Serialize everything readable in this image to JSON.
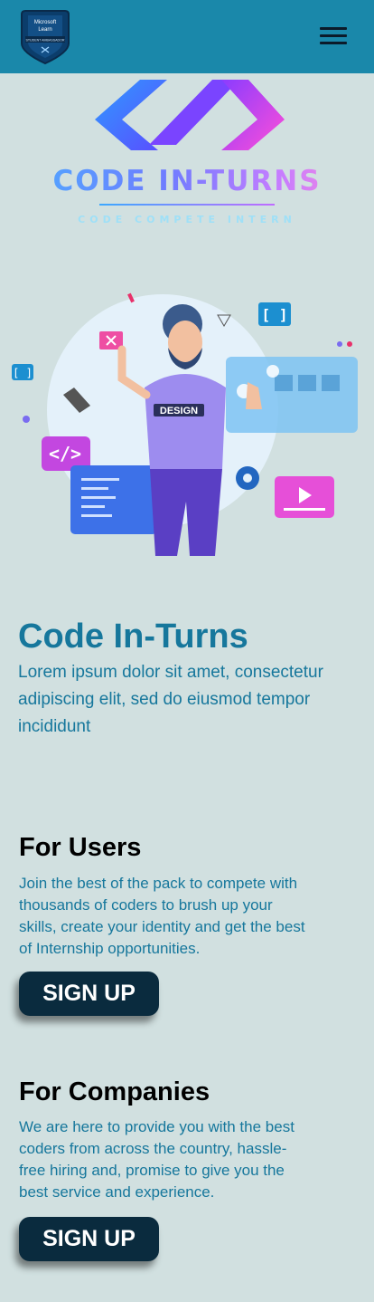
{
  "header": {
    "badge_org": "Microsoft",
    "badge_product": "Learn",
    "badge_program": "STUDENT AMBASSADOR",
    "menu_icon": "hamburger-menu-icon"
  },
  "brand": {
    "name": "CODE IN-TURNS",
    "tagline": "CODE COMPETE INTERN"
  },
  "hero": {
    "title": "Code In-Turns",
    "text": "Lorem ipsum dolor sit amet, consectetur adipiscing elit, sed do eiusmod tempor incididunt",
    "illustration_label": "DESIGN",
    "bracket_label": "[ ]",
    "code_label": "</>"
  },
  "users": {
    "title": "For Users",
    "text": "Join the best of the pack to compete with thousands of coders to brush up your skills, create your identity and get the best of Internship opportunities.",
    "button": "SIGN UP"
  },
  "companies": {
    "title": "For Companies",
    "text": "We are here to provide you with the best coders from across the country, hassle-free hiring and, promise to give you the best service and experience.",
    "button": "SIGN UP"
  },
  "colors": {
    "header_bg": "#1a88aa",
    "page_bg": "#d1e0e0",
    "accent_text": "#16779c",
    "button_bg": "#0a2b3e"
  }
}
